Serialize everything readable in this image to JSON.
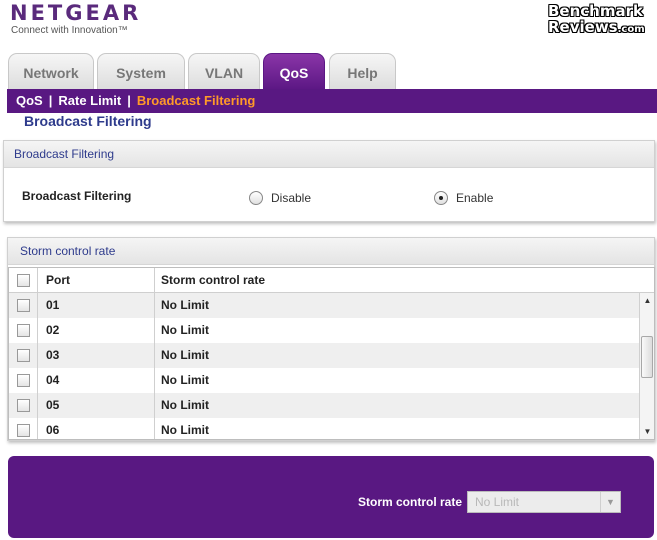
{
  "header": {
    "logo": "NETGEAR",
    "tagline": "Connect with Innovation™",
    "watermark_line1": "Benchmark",
    "watermark_line2": "Reviews",
    "watermark_suffix": ".com"
  },
  "tabs": [
    {
      "label": "Network",
      "active": false
    },
    {
      "label": "System",
      "active": false
    },
    {
      "label": "VLAN",
      "active": false
    },
    {
      "label": "QoS",
      "active": true
    },
    {
      "label": "Help",
      "active": false
    }
  ],
  "subnav": {
    "items": [
      "QoS",
      "Rate Limit",
      "Broadcast Filtering"
    ],
    "separator": "|",
    "current": "Broadcast Filtering"
  },
  "page_title": "Broadcast Filtering",
  "broadcast_panel": {
    "header": "Broadcast Filtering",
    "field_label": "Broadcast Filtering",
    "options": [
      {
        "label": "Disable",
        "selected": false
      },
      {
        "label": "Enable",
        "selected": true
      }
    ]
  },
  "storm_panel": {
    "header": "Storm control rate",
    "columns": [
      "Port",
      "Storm control rate"
    ],
    "rows": [
      {
        "port": "01",
        "rate": "No Limit"
      },
      {
        "port": "02",
        "rate": "No Limit"
      },
      {
        "port": "03",
        "rate": "No Limit"
      },
      {
        "port": "04",
        "rate": "No Limit"
      },
      {
        "port": "05",
        "rate": "No Limit"
      },
      {
        "port": "06",
        "rate": "No Limit"
      }
    ]
  },
  "edit_panel": {
    "label": "Storm control rate",
    "select_value": "No Limit"
  },
  "colors": {
    "brand_purple": "#591882",
    "active_subnav": "#ff9a28",
    "title_blue": "#2e3b8c"
  }
}
